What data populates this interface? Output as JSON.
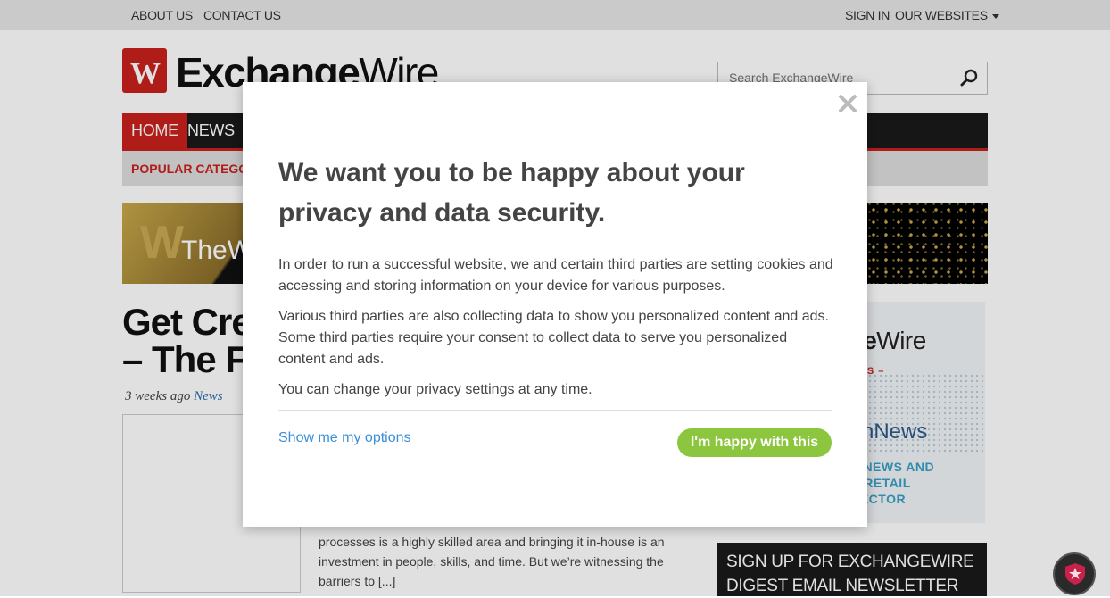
{
  "topbar": {
    "about": "ABOUT US",
    "contact": "CONTACT US",
    "signin": "SIGN IN",
    "websites": "OUR WEBSITES"
  },
  "logo": {
    "bold": "Exchange",
    "thin": "Wire"
  },
  "search": {
    "placeholder": "Search ExchangeWire"
  },
  "nav": {
    "items": [
      {
        "label": "HOME"
      },
      {
        "label": "NEWS"
      }
    ]
  },
  "subnav": {
    "label": "POPULAR CATEGOR"
  },
  "banner": {
    "title_fragment": "TheW"
  },
  "article": {
    "headline_line1": "Get Crea",
    "headline_line2": "– The Fu",
    "date": "3 weeks ago",
    "category": "News",
    "excerpt": "processes is a highly skilled area and bringing it in-house is an investment in people, skills, and time. But we’re witnessing the barriers to [...]"
  },
  "side_ad": {
    "brand_bold": "nge",
    "brand_thin": "Wire",
    "trends": "NDS –",
    "tech": "chNews",
    "news_lines": "T NEWS AND\nE RETAIL\nSECTOR"
  },
  "signup": {
    "text": "SIGN UP FOR EXCHANGEWIRE DIGEST EMAIL NEWSLETTER"
  },
  "modal": {
    "title": "We want you to be happy about your privacy and data security.",
    "p1": "In order to run a successful website, we and certain third parties are setting cookies and accessing and storing information on your device for various purposes.",
    "p2": "Various third parties are also collecting data to show you personalized content and ads. Some third parties require your consent to collect data to serve you personalized content and ads.",
    "p3": "You can change your privacy settings at any time.",
    "options_link": "Show me my options",
    "accept_button": "I'm happy with this"
  },
  "colors": {
    "brand_red": "#c9221c",
    "accept_green": "#8cc63f",
    "link_blue": "#3a8fd6"
  },
  "icons": {
    "search": "search-icon",
    "close": "close-icon",
    "badge": "shield-star-icon"
  }
}
